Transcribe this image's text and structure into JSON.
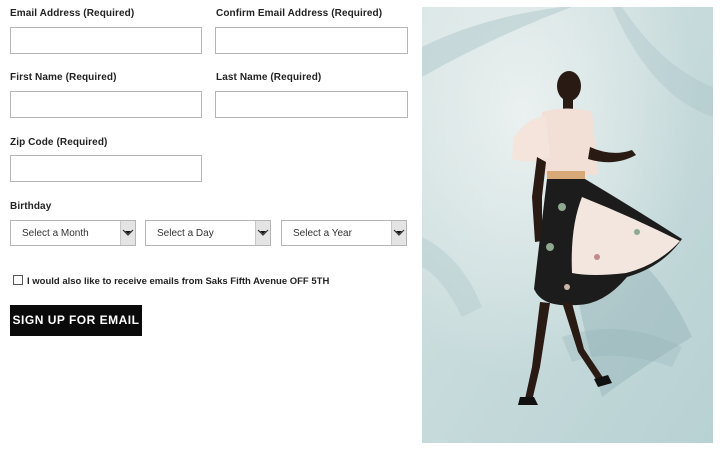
{
  "form": {
    "email": {
      "label": "Email Address (Required)",
      "value": ""
    },
    "confirm_email": {
      "label": "Confirm Email Address (Required)",
      "value": ""
    },
    "first_name": {
      "label": "First Name (Required)",
      "value": ""
    },
    "last_name": {
      "label": "Last Name (Required)",
      "value": ""
    },
    "zip": {
      "label": "Zip Code (Required)",
      "value": ""
    },
    "birthday": {
      "label": "Birthday",
      "month": "Select a Month",
      "day": "Select a Day",
      "year": "Select a Year"
    },
    "optin_label": "I would also like to receive emails from Saks Fifth Avenue OFF 5TH",
    "submit_label": "SIGN UP FOR EMAIL"
  },
  "icons": {
    "dropdown": "chevron-down-icon",
    "checkbox": "checkbox-unchecked"
  },
  "colors": {
    "button_bg": "#0a0a0a",
    "button_text": "#ffffff",
    "border": "#b5b5b5",
    "photo_bg": "#c9dcdd"
  }
}
